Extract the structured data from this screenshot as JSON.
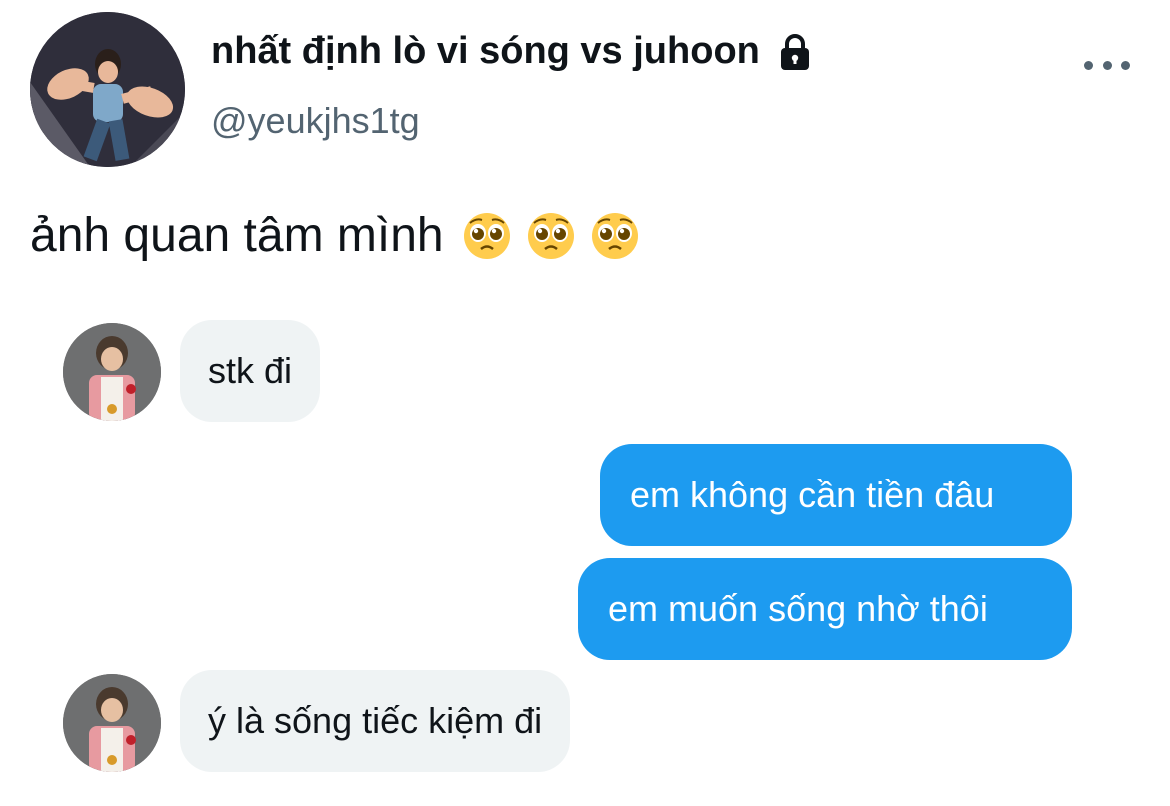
{
  "profile": {
    "display_name": "nhất định lò vi sóng vs juhoon",
    "handle": "@yeukjhs1tg",
    "locked_icon": "lock-icon",
    "avatar_icon": "profile-photo",
    "more_icon": "more-options-icon"
  },
  "tweet": {
    "text": "ảnh quan tâm mình",
    "emojis": [
      "pleading-face-emoji",
      "pleading-face-emoji",
      "pleading-face-emoji"
    ]
  },
  "messages": [
    {
      "from": "them",
      "text": "stk đi"
    },
    {
      "from": "me",
      "text": "em không cần tiền đâu"
    },
    {
      "from": "me",
      "text": "em muốn sống nhờ thôi"
    },
    {
      "from": "them",
      "text": "ý là sống tiếc kiệm đi"
    }
  ],
  "colors": {
    "accent": "#1d9bf0",
    "incoming_bubble": "#eff3f4",
    "secondary_text": "#536471"
  }
}
